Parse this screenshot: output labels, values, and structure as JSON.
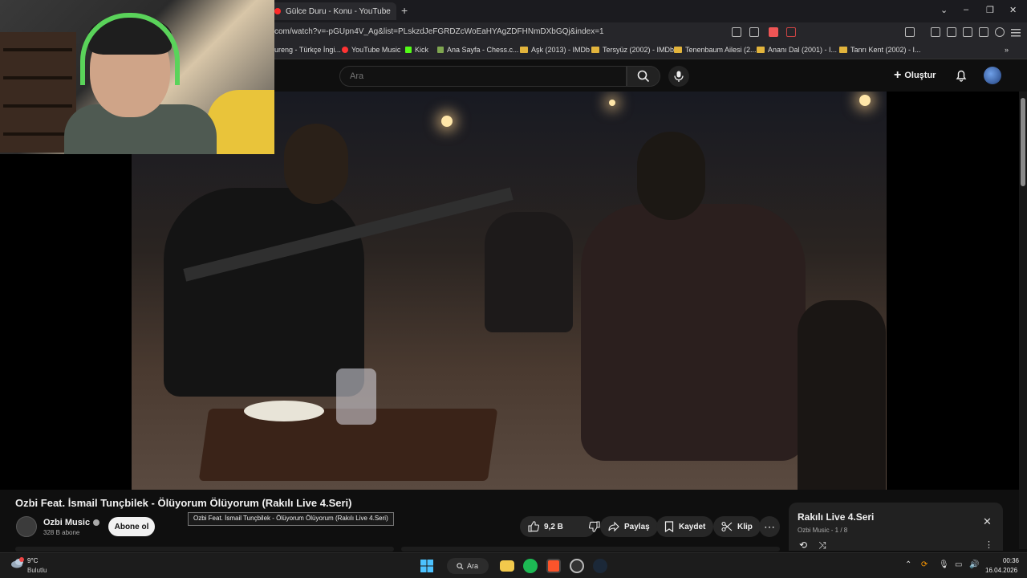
{
  "browser": {
    "tab_title": "Gülce Duru - Konu - YouTube",
    "url": "com/watch?v=-pGUpn4V_Ag&list=PLskzdJeFGRDZcWoEaHYAgZDFHNmDXbGQj&index=1",
    "bookmarks": [
      "ureng - Türkçe İngi...",
      "YouTube Music",
      "Kick",
      "Ana Sayfa - Chess.c...",
      "Aşk (2013) - IMDb",
      "Tersyüz (2002) - IMDb",
      "Tenenbaum Ailesi (2...",
      "Ananı Dal (2001) - I...",
      "Tanrı Kent (2002) - I..."
    ]
  },
  "header": {
    "search_placeholder": "Ara",
    "create_label": "Oluştur"
  },
  "video": {
    "title": "Ozbi Feat. İsmail Tunçbilek - Ölüyorum Ölüyorum (Rakılı Live 4.Seri)",
    "tooltip": "Ozbi Feat. İsmail Tunçbilek - Ölüyorum Ölüyorum (Rakılı Live 4.Seri)",
    "channel": "Ozbi Music",
    "subscribers": "328 B abone",
    "subscribe_label": "Abone ol",
    "like_count": "9,2 B",
    "share_label": "Paylaş",
    "save_label": "Kaydet",
    "clip_label": "Klip"
  },
  "playlist": {
    "title": "Rakılı Live 4.Seri",
    "subtitle": "Ozbi Music - 1 / 8"
  },
  "taskbar": {
    "temperature": "9°C",
    "weather": "Bulutlu",
    "search_label": "Ara",
    "time": "00:36",
    "date": "16.04.2026"
  },
  "colors": {
    "bg": "#0f0f0f",
    "accent_red": "#ff0000",
    "bookmark_folder": "#e2b43c"
  }
}
